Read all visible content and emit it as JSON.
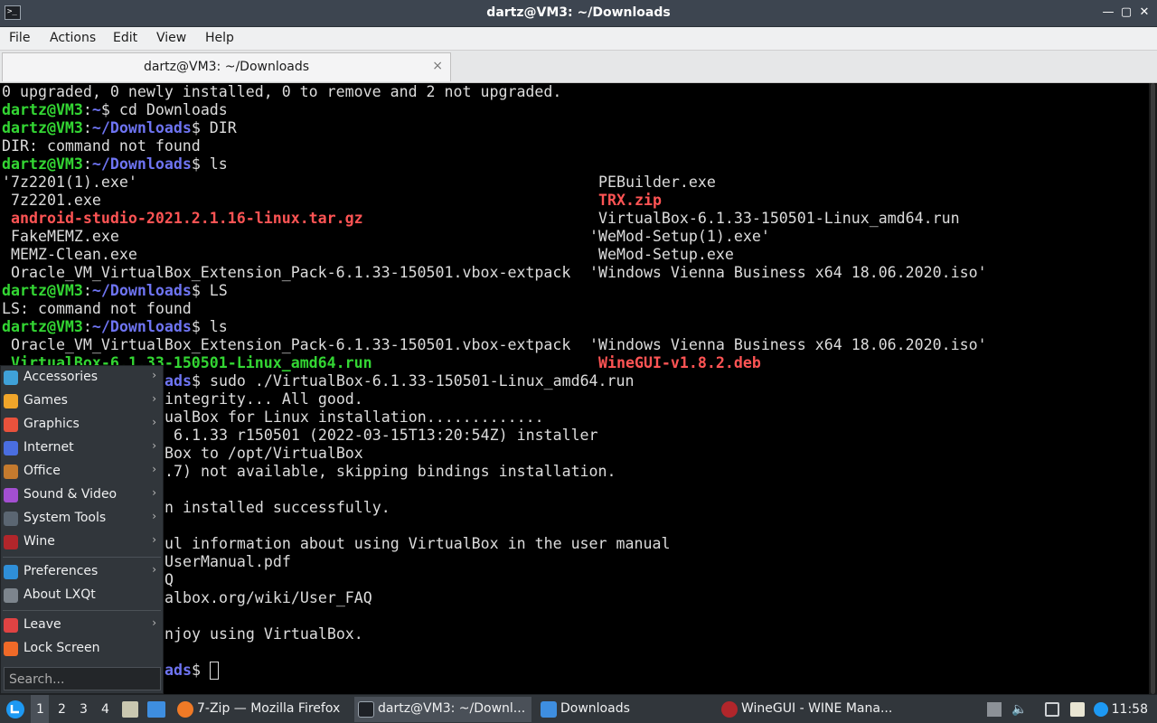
{
  "window": {
    "title": "dartz@VM3: ~/Downloads",
    "app_icon_glyph": ">_"
  },
  "menubar": {
    "file": "File",
    "actions": "Actions",
    "edit": "Edit",
    "view": "View",
    "help": "Help"
  },
  "tab": {
    "label": "dartz@VM3: ~/Downloads",
    "close": "×"
  },
  "terminal": {
    "user": "dartz@VM3",
    "lines": {
      "l0": "0 upgraded, 0 newly installed, 0 to remove and 2 not upgraded.",
      "p1_path": "~",
      "p1_cmd": "$ cd Downloads",
      "p2_path": "~/Downloads",
      "p2_cmd": "$ DIR",
      "l3": "DIR: command not found",
      "p4_cmd": "$ ls",
      "ls1": [
        [
          "'7z2201(1).exe'",
          "PEBuilder.exe"
        ],
        [
          " 7z2201.exe",
          "TRX.zip"
        ],
        [
          "android-studio-2021.2.1.16-linux.tar.gz",
          "VirtualBox-6.1.33-150501-Linux_amd64.run"
        ],
        [
          " FakeMEMZ.exe",
          "'WeMod-Setup(1).exe'"
        ],
        [
          " MEMZ-Clean.exe",
          "WeMod-Setup.exe"
        ],
        [
          " Oracle_VM_VirtualBox_Extension_Pack-6.1.33-150501.vbox-extpack",
          "'Windows Vienna Business x64 18.06.2020.iso'"
        ]
      ],
      "p5_cmd": "$ LS",
      "l11": "LS: command not found",
      "p6_cmd": "$ ls",
      "ls2": [
        [
          " Oracle_VM_VirtualBox_Extension_Pack-6.1.33-150501.vbox-extpack",
          "'Windows Vienna Business x64 18.06.2020.iso'"
        ],
        [
          "VirtualBox-6.1.33-150501-Linux_amd64.run",
          "WineGUI-v1.8.2.deb"
        ]
      ],
      "p7_tail": "ads",
      "p7_cmd": "$ sudo ./VirtualBox-6.1.33-150501-Linux_amd64.run",
      "l15": "integrity... All good.",
      "l16": "ualBox for Linux installation.............",
      "l17": " 6.1.33 r150501 (2022-03-15T13:20:54Z) installer",
      "l18": "Box to /opt/VirtualBox",
      "l19": ".7) not available, skipping bindings installation.",
      "l21": "n installed successfully.",
      "l23": "ul information about using VirtualBox in the user manual",
      "l24": "UserManual.pdf",
      "l25": "Q",
      "l26": "albox.org/wiki/User_FAQ",
      "l28": "njoy using VirtualBox.",
      "p_last_tail": "ads",
      "p_last_cmd": "$ "
    }
  },
  "startmenu": {
    "items": [
      {
        "label": "Accessories",
        "icon": "accessories-icon",
        "color": "#3fa1d8"
      },
      {
        "label": "Games",
        "icon": "games-icon",
        "color": "#f0a52a"
      },
      {
        "label": "Graphics",
        "icon": "graphics-icon",
        "color": "#e8523c"
      },
      {
        "label": "Internet",
        "icon": "internet-icon",
        "color": "#4a6ee0"
      },
      {
        "label": "Office",
        "icon": "office-icon",
        "color": "#c47a2e"
      },
      {
        "label": "Sound & Video",
        "icon": "sound-video-icon",
        "color": "#a34fd1"
      },
      {
        "label": "System Tools",
        "icon": "system-tools-icon",
        "color": "#5b6672"
      },
      {
        "label": "Wine",
        "icon": "wine-icon",
        "color": "#b1262b"
      },
      {
        "label": "Preferences",
        "icon": "preferences-icon",
        "color": "#2f8fd8"
      },
      {
        "label": "About LXQt",
        "icon": "about-icon",
        "color": "#7d858d"
      },
      {
        "label": "Leave",
        "icon": "leave-icon",
        "color": "#e04343"
      },
      {
        "label": "Lock Screen",
        "icon": "lock-icon",
        "color": "#f06a28"
      }
    ],
    "search_placeholder": "Search..."
  },
  "taskbar": {
    "desktops": [
      "1",
      "2",
      "3",
      "4"
    ],
    "windows": [
      {
        "label": "7-Zip — Mozilla Firefox",
        "icon": "firefox-icon",
        "color": "#f07a26"
      },
      {
        "label": "dartz@VM3: ~/Downl...",
        "icon": "terminal-icon",
        "color": "#3d4550"
      },
      {
        "label": "Downloads",
        "icon": "folder-icon",
        "color": "#3e8ee0"
      },
      {
        "label": "WineGUI - WINE Mana...",
        "icon": "winegui-icon",
        "color": "#b1262b"
      }
    ],
    "clock": "11:58"
  }
}
